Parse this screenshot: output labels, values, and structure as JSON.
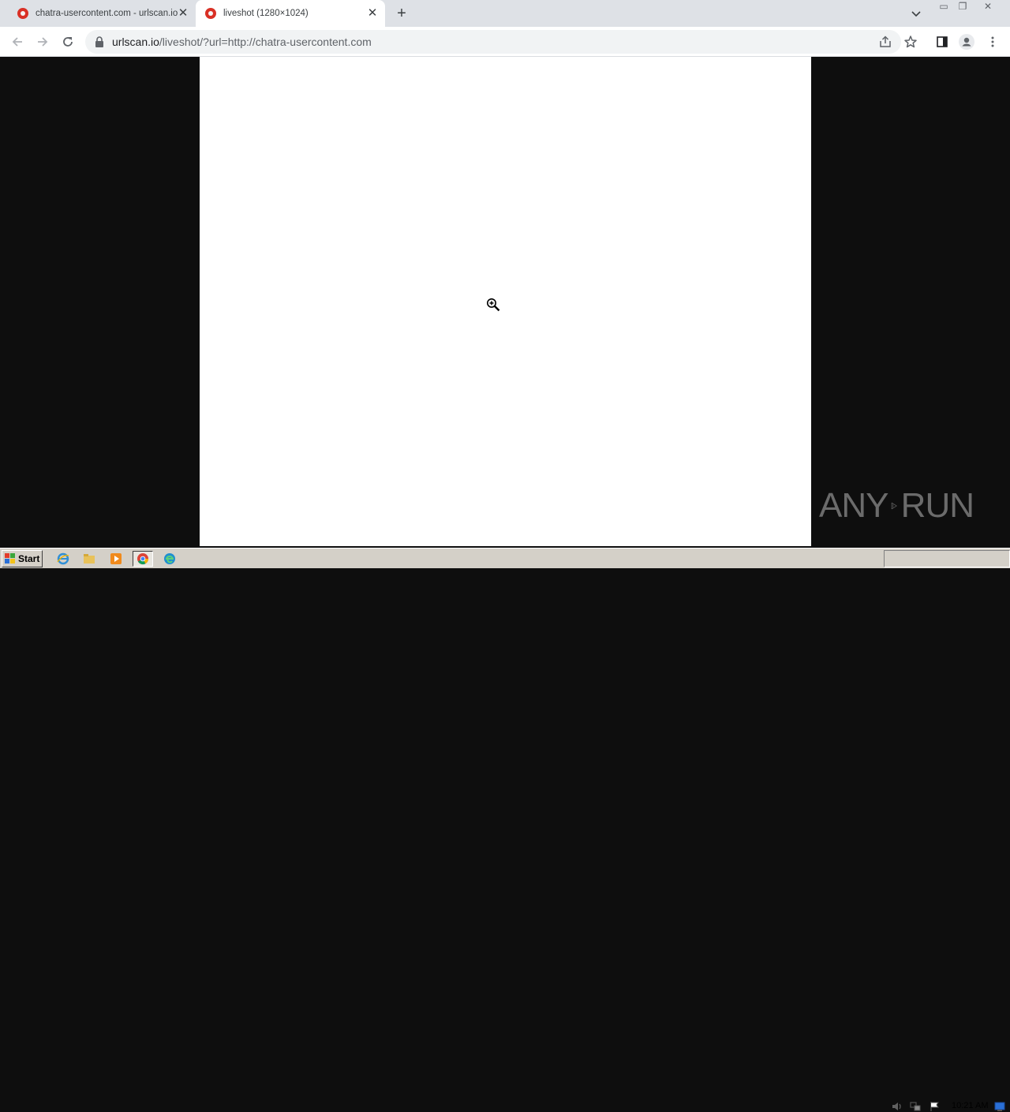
{
  "browser": {
    "tabs": [
      {
        "title": "chatra-usercontent.com - urlscan.io",
        "active": false
      },
      {
        "title": "liveshot (1280×1024)",
        "active": true
      }
    ],
    "new_tab_symbol": "+",
    "close_symbol": "✕",
    "address": {
      "host": "urlscan.io",
      "rest": "/liveshot/?url=http://chatra-usercontent.com"
    },
    "window_controls": {
      "minimize": "▭",
      "restore": "❐",
      "close": "✕"
    }
  },
  "watermark": {
    "left": "ANY",
    "right": "RUN"
  },
  "taskbar": {
    "start_label": "Start",
    "clock": "10:21 AM",
    "apps": [
      "internet-explorer-icon",
      "file-explorer-icon",
      "media-player-icon",
      "chrome-icon",
      "edge-icon"
    ]
  },
  "colors": {
    "tab_strip": "#dee1e6",
    "page_background": "#0e0e0e",
    "screenshot_background": "#ffffff",
    "favicon": "#d93025",
    "taskbar": "#d4d0c8"
  }
}
